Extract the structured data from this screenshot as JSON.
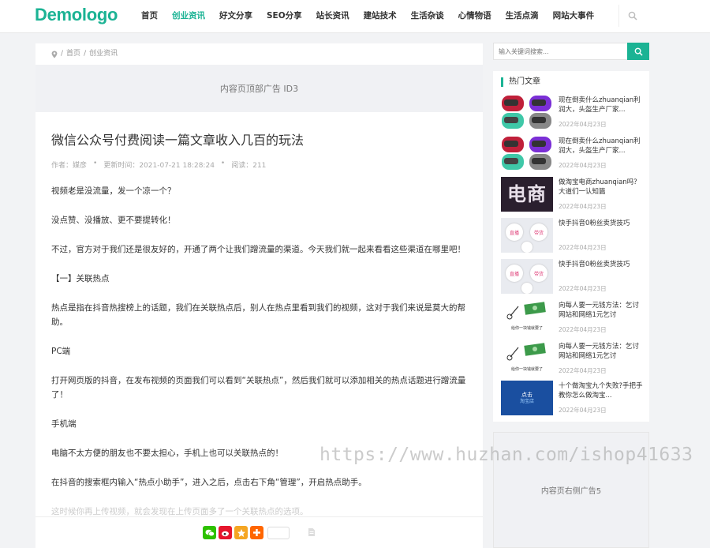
{
  "header": {
    "logo": "Demologo",
    "nav": [
      "首页",
      "创业资讯",
      "好文分享",
      "SEO分享",
      "站长资讯",
      "建站技术",
      "生活杂谈",
      "心情物语",
      "生活点滴",
      "网站大事件"
    ],
    "active_nav": "创业资讯"
  },
  "breadcrumb": {
    "home": "首页",
    "category": "创业资讯",
    "sep": "/"
  },
  "ads": {
    "top": "内容页顶部广告 ID3",
    "side": "内容页右侧广告5"
  },
  "article": {
    "title": "微信公众号付费阅读一篇文章收入几百的玩法",
    "author": "作者：媒彦",
    "updated": "更新时间：2021-07-21 18:28:24",
    "reads": "阅读：211",
    "paragraphs": [
      "视频老是没流量，发一个凉一个？",
      "没点赞、没播放、更不要提转化！",
      "不过，官方对于我们还是很友好的，开通了两个让我们蹭流量的渠道。今天我们就一起来看看这些渠道在哪里吧！",
      "【一】关联热点",
      "热点是指在抖音热搜榜上的话题，我们在关联热点后，别人在热点里看到我们的视频，这对于我们来说是莫大的帮助。",
      "PC端",
      "打开网页版的抖音，在发布视频的页面我们可以看到“关联热点”，然后我们就可以添加相关的热点话题进行蹭流量了！",
      "手机端",
      "电脑不太方便的朋友也不要太担心，手机上也可以关联热点的！",
      "在抖音的搜索框内输入“热点小助手”，进入之后，点击右下角“管理”，开启热点助手。",
      "这时候你再上传视频，就会发现在上传页面多了一个关联热点的选项。"
    ]
  },
  "sidebar": {
    "search_placeholder": "输入关键词搜索...",
    "hot_title": "热门文章",
    "items": [
      {
        "title": "现在倒卖什么zhuanqian利润大，头盔生产厂家...",
        "date": "2022年04月23日",
        "thumb": "helmet"
      },
      {
        "title": "现在倒卖什么zhuanqian利润大，头盔生产厂家...",
        "date": "2022年04月23日",
        "thumb": "helmet"
      },
      {
        "title": "做淘宝电商zhuanqian吗？大道们一认知篇",
        "date": "2022年04月23日",
        "thumb": "dianshang"
      },
      {
        "title": "快手抖音0粉丝卖货技巧",
        "date": "2022年04月23日",
        "thumb": "balls"
      },
      {
        "title": "快手抖音0粉丝卖货技巧",
        "date": "2022年04月23日",
        "thumb": "balls"
      },
      {
        "title": "向每人要一元钱方法：乞讨网站和网络1元乞讨",
        "date": "2022年04月23日",
        "thumb": "money"
      },
      {
        "title": "向每人要一元钱方法：乞讨网站和网络1元乞讨",
        "date": "2022年04月23日",
        "thumb": "money"
      },
      {
        "title": "十个做淘宝九个失败?手把手教你怎么做淘宝...",
        "date": "2022年04月23日",
        "thumb": "taobao"
      }
    ]
  },
  "thumb_text": {
    "dianshang": "电商",
    "balls_left": "直播",
    "balls_right": "带货",
    "money_caption": "给你一块钱就要了",
    "taobao_line1": "点击",
    "taobao_line2": "淘宝店"
  },
  "watermark": "https://www.huzhan.com/ishop41633",
  "colors": {
    "accent": "#1bb394",
    "wechat": "#2dc100",
    "weibo": "#e6162d",
    "qzone": "#f5a623",
    "more": "#ff6600"
  }
}
